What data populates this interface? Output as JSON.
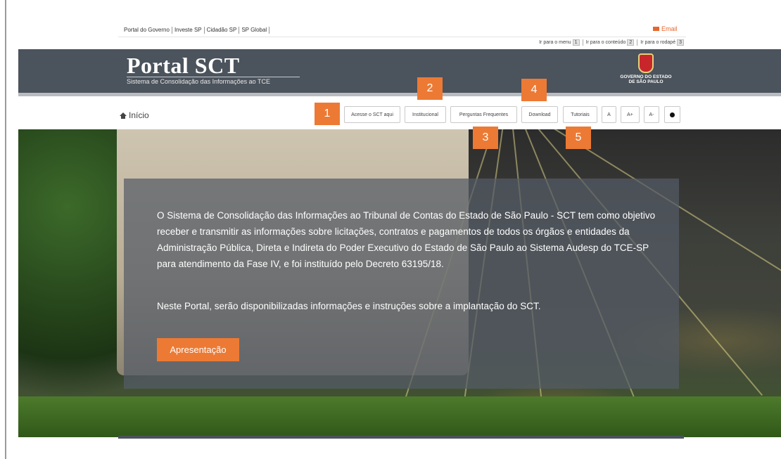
{
  "gov_bar": {
    "links": [
      "Portal do Governo",
      "Investe SP",
      "Cidadão SP",
      "SP Global"
    ],
    "email_label": "Email"
  },
  "skip_links": [
    {
      "label": "Ir para o menu",
      "key": "1"
    },
    {
      "label": "Ir para o conteúdo",
      "key": "2"
    },
    {
      "label": "Ir para o rodapé",
      "key": "3"
    }
  ],
  "header": {
    "title": "Portal SCT",
    "subtitle": "Sistema de Consolidação das Informações ao TCE",
    "gov_logo_line1": "GOVERNO DO ESTADO",
    "gov_logo_line2": "DE SÃO PAULO"
  },
  "nav": {
    "home_label": "Início",
    "buttons": [
      "Acesse o SCT aqui",
      "Institucional",
      "Perguntas Frequentes",
      "Download",
      "Tutoriais"
    ],
    "font_buttons": [
      "A",
      "A+",
      "A-"
    ]
  },
  "callouts": [
    "1",
    "2",
    "3",
    "4",
    "5"
  ],
  "hero": {
    "paragraph1": "O Sistema de Consolidação das Informações ao Tribunal de Contas do Estado de São Paulo - SCT tem como objetivo receber e transmitir as informações sobre licitações,  contratos e pagamentos de todos os órgãos e entidades da Administração Pública, Direta e Indireta do Poder Executivo do Estado de São Paulo ao Sistema Audesp do TCE-SP para atendimento da Fase IV, e foi instituído pelo Decreto 63195/18.",
    "paragraph2": "Neste Portal, serão disponibilizadas informações e instruções sobre a implantação do SCT.",
    "button_label": "Apresentação"
  },
  "colors": {
    "accent": "#ec7a34",
    "header_bg": "#4b535c"
  }
}
